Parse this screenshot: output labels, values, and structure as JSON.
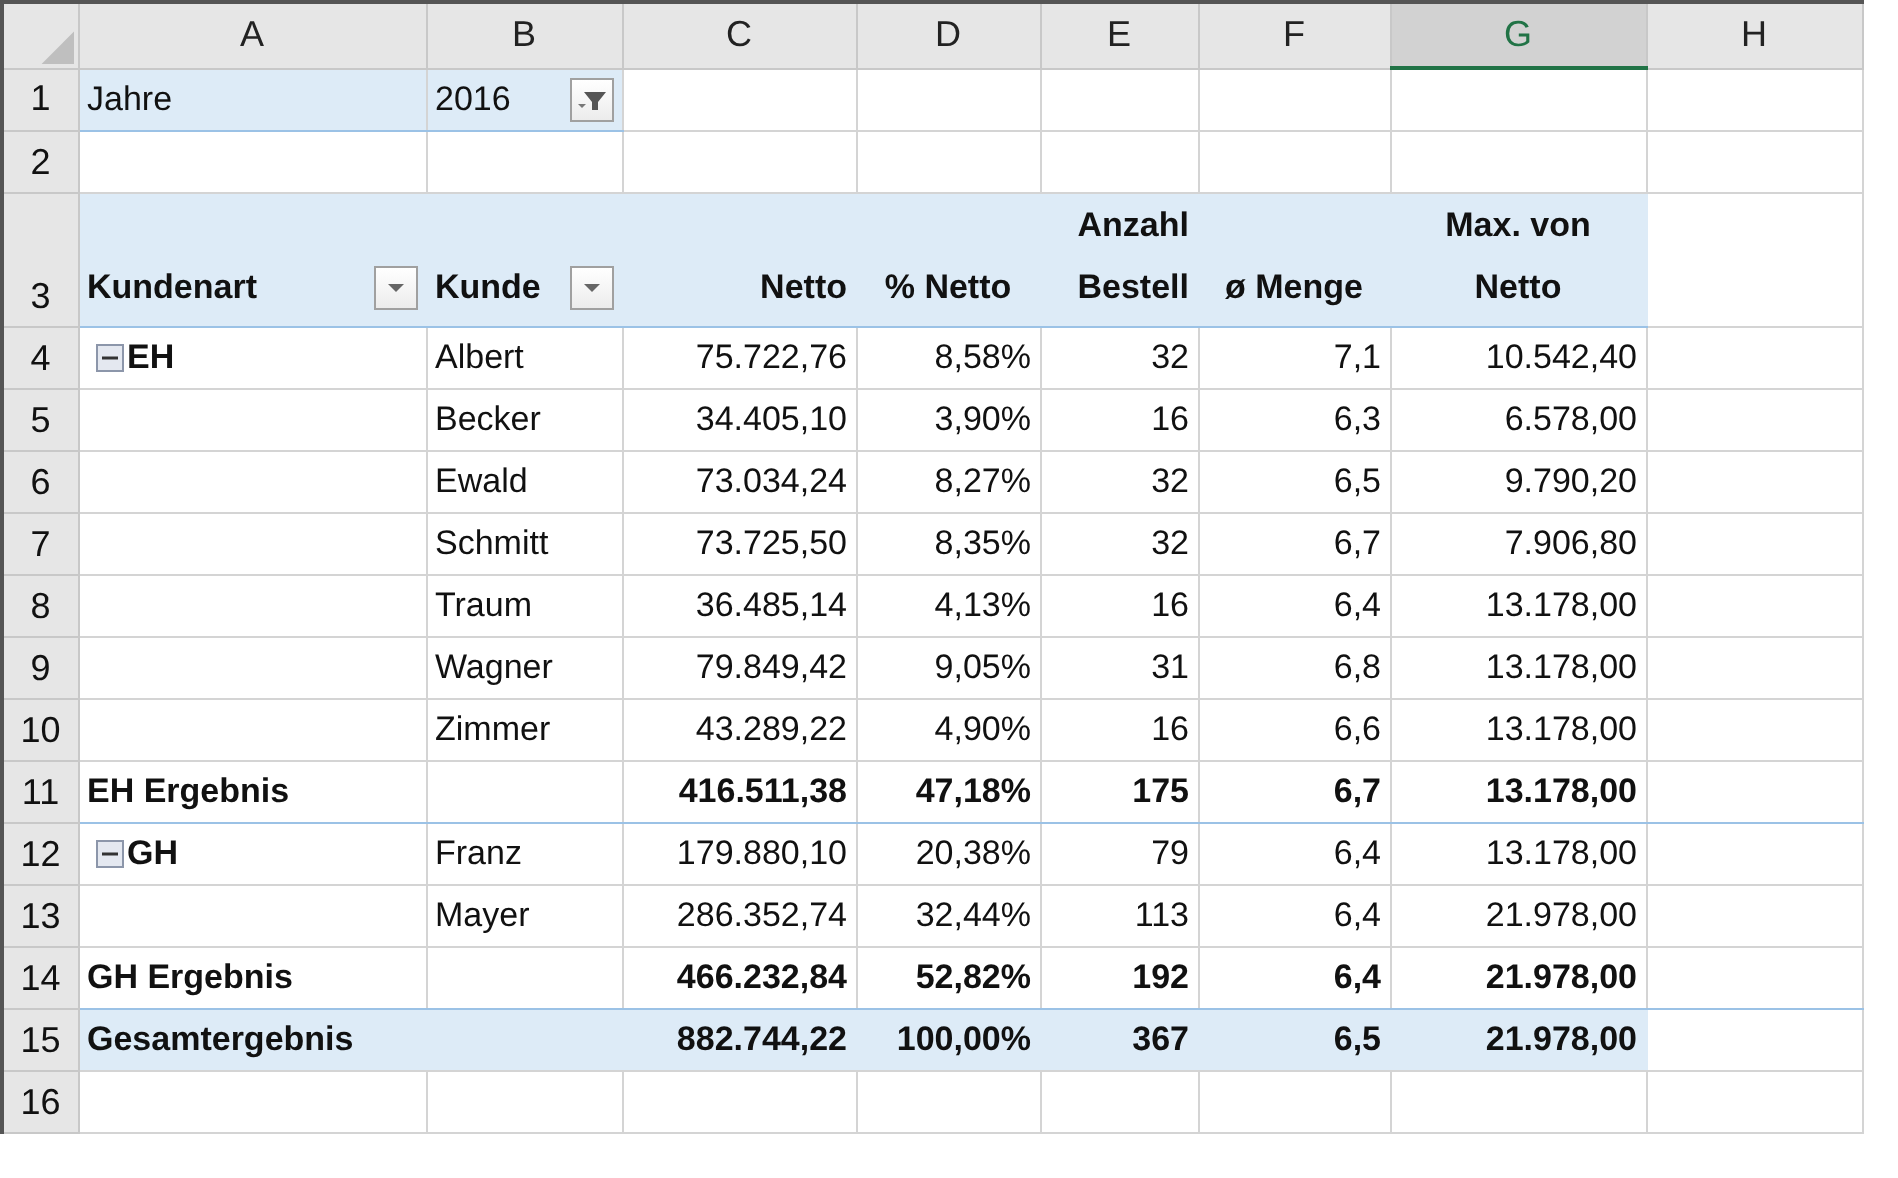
{
  "columns": [
    {
      "label": "A",
      "selected": false
    },
    {
      "label": "B",
      "selected": false
    },
    {
      "label": "C",
      "selected": false
    },
    {
      "label": "D",
      "selected": false
    },
    {
      "label": "E",
      "selected": false
    },
    {
      "label": "F",
      "selected": false
    },
    {
      "label": "G",
      "selected": true
    },
    {
      "label": "H",
      "selected": false
    }
  ],
  "rows": [
    {
      "number": "1",
      "kind": "filter",
      "label": "Jahre",
      "value": "2016"
    },
    {
      "number": "2",
      "kind": "blank"
    },
    {
      "number": "3",
      "kind": "header",
      "headers": [
        {
          "text": "Kundenart",
          "dropdown": true
        },
        {
          "text": "Kunde",
          "dropdown": true
        },
        {
          "text": "Netto",
          "dropdown": false
        },
        {
          "text": "% Netto",
          "dropdown": false
        },
        {
          "text": "Anzahl Bestell",
          "dropdown": false
        },
        {
          "text": "ø Menge",
          "dropdown": false
        },
        {
          "text": "Max. von Netto",
          "dropdown": false
        }
      ]
    },
    {
      "number": "4",
      "kind": "data",
      "group": "EH",
      "expanded": true,
      "customer": "Albert",
      "values": [
        "75.722,76",
        "8,58%",
        "32",
        "7,1",
        "10.542,40"
      ]
    },
    {
      "number": "5",
      "kind": "data",
      "customer": "Becker",
      "values": [
        "34.405,10",
        "3,90%",
        "16",
        "6,3",
        "6.578,00"
      ]
    },
    {
      "number": "6",
      "kind": "data",
      "customer": "Ewald",
      "values": [
        "73.034,24",
        "8,27%",
        "32",
        "6,5",
        "9.790,20"
      ]
    },
    {
      "number": "7",
      "kind": "data",
      "customer": "Schmitt",
      "values": [
        "73.725,50",
        "8,35%",
        "32",
        "6,7",
        "7.906,80"
      ]
    },
    {
      "number": "8",
      "kind": "data",
      "customer": "Traum",
      "values": [
        "36.485,14",
        "4,13%",
        "16",
        "6,4",
        "13.178,00"
      ]
    },
    {
      "number": "9",
      "kind": "data",
      "customer": "Wagner",
      "values": [
        "79.849,42",
        "9,05%",
        "31",
        "6,8",
        "13.178,00"
      ]
    },
    {
      "number": "10",
      "kind": "data",
      "customer": "Zimmer",
      "values": [
        "43.289,22",
        "4,90%",
        "16",
        "6,6",
        "13.178,00"
      ]
    },
    {
      "number": "11",
      "kind": "subtotal",
      "label": "EH Ergebnis",
      "values": [
        "416.511,38",
        "47,18%",
        "175",
        "6,7",
        "13.178,00"
      ]
    },
    {
      "number": "12",
      "kind": "data",
      "group": "GH",
      "expanded": true,
      "customer": "Franz",
      "values": [
        "179.880,10",
        "20,38%",
        "79",
        "6,4",
        "13.178,00"
      ]
    },
    {
      "number": "13",
      "kind": "data",
      "customer": "Mayer",
      "values": [
        "286.352,74",
        "32,44%",
        "113",
        "6,4",
        "21.978,00"
      ]
    },
    {
      "number": "14",
      "kind": "subtotal",
      "label": "GH Ergebnis",
      "values": [
        "466.232,84",
        "52,82%",
        "192",
        "6,4",
        "21.978,00"
      ]
    },
    {
      "number": "15",
      "kind": "total",
      "label": "Gesamtergebnis",
      "values": [
        "882.744,22",
        "100,00%",
        "367",
        "6,5",
        "21.978,00"
      ]
    },
    {
      "number": "16",
      "kind": "blank"
    }
  ]
}
